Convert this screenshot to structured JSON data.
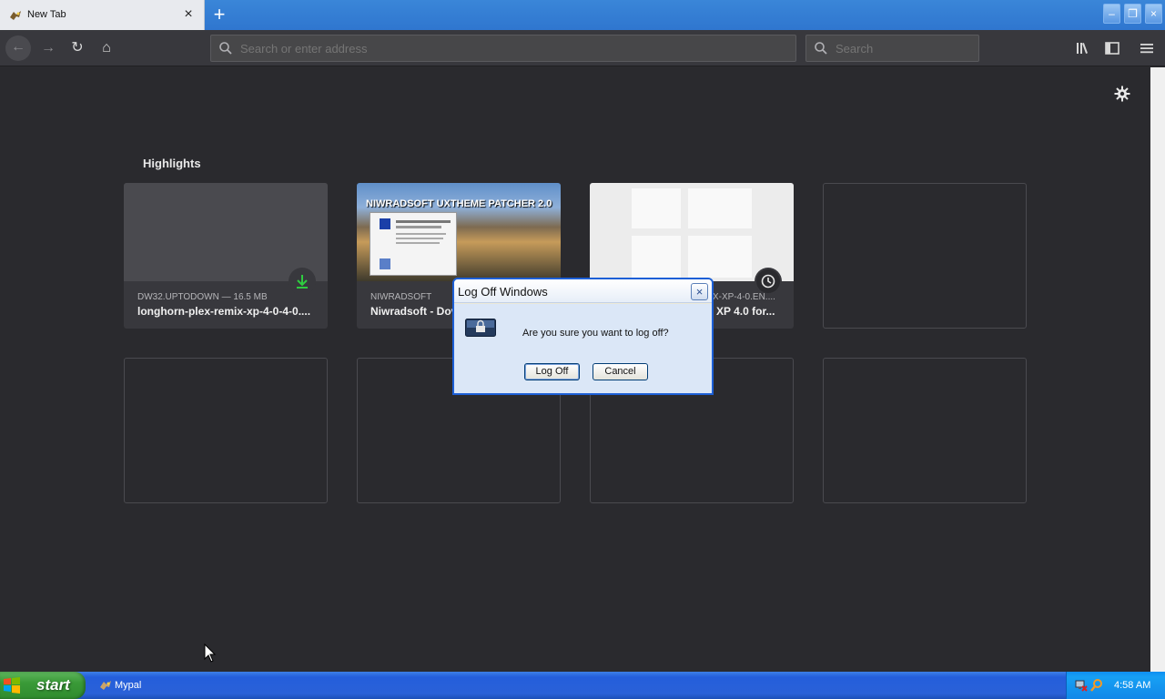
{
  "browser": {
    "tab_title": "New Tab",
    "tab_close": "×",
    "new_tab": "+",
    "window_min": "–",
    "window_max": "❐",
    "window_close": "×"
  },
  "toolbar": {
    "back": "←",
    "forward": "→",
    "reload": "↻",
    "home": "⌂",
    "url_placeholder": "Search or enter address",
    "search_placeholder": "Search"
  },
  "highlights": {
    "heading": "Highlights",
    "cards": [
      {
        "meta": "DW32.UPTODOWN — 16.5 MB",
        "title": "longhorn-plex-remix-xp-4-0-4-0...."
      },
      {
        "meta": "NIWRADSOFT",
        "title": "Niwradsoft - Dov"
      },
      {
        "meta": "X-XP-4-0.EN....",
        "title": "XP 4.0 for..."
      }
    ],
    "thumb_banner": "NIWRADSOFT UXTHEME PATCHER 2.0"
  },
  "dialog": {
    "title": "Log Off Windows",
    "message": "Are you sure you want to log off?",
    "ok_label": "Log Off",
    "cancel_label": "Cancel",
    "close": "×"
  },
  "taskbar": {
    "start_label": "start",
    "task_label": "Mypal",
    "clock": "4:58 AM"
  },
  "colors": {
    "content_bg": "#2a2a2e",
    "accent": "#2f76cf",
    "download_green": "#2ecc40"
  }
}
